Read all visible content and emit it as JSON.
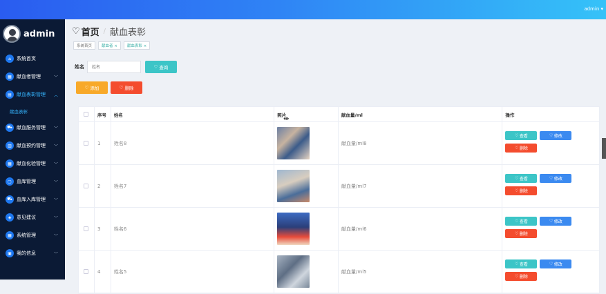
{
  "topbar": {
    "user": "admin ▾"
  },
  "sidebar": {
    "brand": "admin",
    "items": [
      {
        "label": "系统首页",
        "icon": "home-icon",
        "glyph": "⌂",
        "active": false,
        "expandable": false
      },
      {
        "label": "献血者管理",
        "icon": "grid-icon",
        "glyph": "▦",
        "active": false,
        "expandable": true
      },
      {
        "label": "献血表彰管理",
        "icon": "book-icon",
        "glyph": "▤",
        "active": true,
        "expandable": true
      },
      {
        "label": "献血服务管理",
        "icon": "truck-icon",
        "glyph": "⛟",
        "active": false,
        "expandable": true
      },
      {
        "label": "献血预约管理",
        "icon": "calendar-icon",
        "glyph": "▥",
        "active": false,
        "expandable": true
      },
      {
        "label": "献血化验管理",
        "icon": "grid-icon",
        "glyph": "▦",
        "active": false,
        "expandable": true
      },
      {
        "label": "血库管理",
        "icon": "chat-icon",
        "glyph": "▢",
        "active": false,
        "expandable": true
      },
      {
        "label": "血库入库管理",
        "icon": "truck-icon",
        "glyph": "⛟",
        "active": false,
        "expandable": true
      },
      {
        "label": "意见建议",
        "icon": "shield-icon",
        "glyph": "◈",
        "active": false,
        "expandable": true
      },
      {
        "label": "系统管理",
        "icon": "grid-icon",
        "glyph": "▦",
        "active": false,
        "expandable": true
      },
      {
        "label": "我的信息",
        "icon": "card-icon",
        "glyph": "▣",
        "active": false,
        "expandable": true
      }
    ],
    "submenu": "献血表彰"
  },
  "header": {
    "home": "首页",
    "separator": "/",
    "current": "献血表彰"
  },
  "tags": [
    "系统首页",
    "献血者 ×",
    "献血表彰 ×"
  ],
  "search": {
    "label": "姓名",
    "placeholder": "姓名",
    "button": "查询"
  },
  "actions": {
    "add": "添加",
    "delete": "删除"
  },
  "table": {
    "headers": [
      "",
      "序号",
      "姓名",
      "照片",
      "献血量/ml",
      "操作"
    ],
    "rows": [
      {
        "index": "1",
        "name": "姓名8",
        "amount": "献血量/ml8"
      },
      {
        "index": "2",
        "name": "姓名7",
        "amount": "献血量/ml7"
      },
      {
        "index": "3",
        "name": "姓名6",
        "amount": "献血量/ml6"
      },
      {
        "index": "4",
        "name": "姓名5",
        "amount": "献血量/ml5"
      }
    ],
    "ops": {
      "view": "查看",
      "edit": "修改",
      "delete": "删除"
    }
  },
  "colors": {
    "accent": "#3cc5c7",
    "edit": "#3b8af0",
    "danger": "#f44c2e",
    "warning": "#f8a929",
    "sidebar": "#0b1a35"
  }
}
